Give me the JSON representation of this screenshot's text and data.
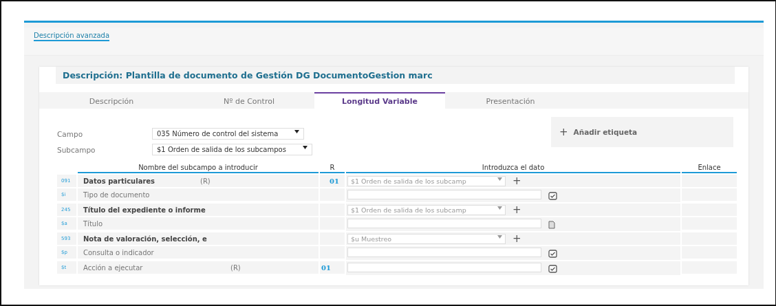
{
  "link": "Descripción avanzada",
  "title": "Descripción: Plantilla de documento de Gestión DG DocumentoGestion marc",
  "tabs": [
    {
      "label": "Descripción",
      "selected": false
    },
    {
      "label": "Nº de Control",
      "selected": false
    },
    {
      "label": "Longitud Variable",
      "selected": true
    },
    {
      "label": "Presentación",
      "selected": false
    }
  ],
  "form": [
    {
      "label": "Campo",
      "value": "035 Número de control del sistema"
    },
    {
      "label": "Subcampo",
      "value": "$1 Orden de salida de los subcampos"
    }
  ],
  "add_button": {
    "icon": "+",
    "label": "Añadir etiqueta"
  },
  "table": {
    "columns": [
      "Nombre del subcampo a introducir",
      "R",
      "Introduzca el dato",
      "Enlace"
    ],
    "rows": [
      {
        "kind": "field",
        "code": "091",
        "name": "Datos particulares",
        "note": "(R)",
        "r": "01",
        "value": "$1 Orden de salida de los subcamp",
        "action": "+"
      },
      {
        "kind": "subfield",
        "code": "$i",
        "name": "Tipo de documento",
        "checked": true
      },
      {
        "kind": "field",
        "code": "245",
        "name": "Título del expediente o informe",
        "value": "$1 Orden de salida de los subcamp",
        "action": "+"
      },
      {
        "kind": "subfield",
        "code": "$a",
        "name": "Título",
        "checked": false
      },
      {
        "kind": "field",
        "code": "593",
        "name": "Nota de valoración, selección, e",
        "value": "$u Muestreo",
        "action": "+"
      },
      {
        "kind": "subfield",
        "code": "$p",
        "name": "Consulta o indicador",
        "checked": true
      },
      {
        "kind": "subfield",
        "code": "$t",
        "name": "Acción a ejecutar",
        "note": "(R)",
        "r": "01",
        "checked": true
      }
    ]
  }
}
